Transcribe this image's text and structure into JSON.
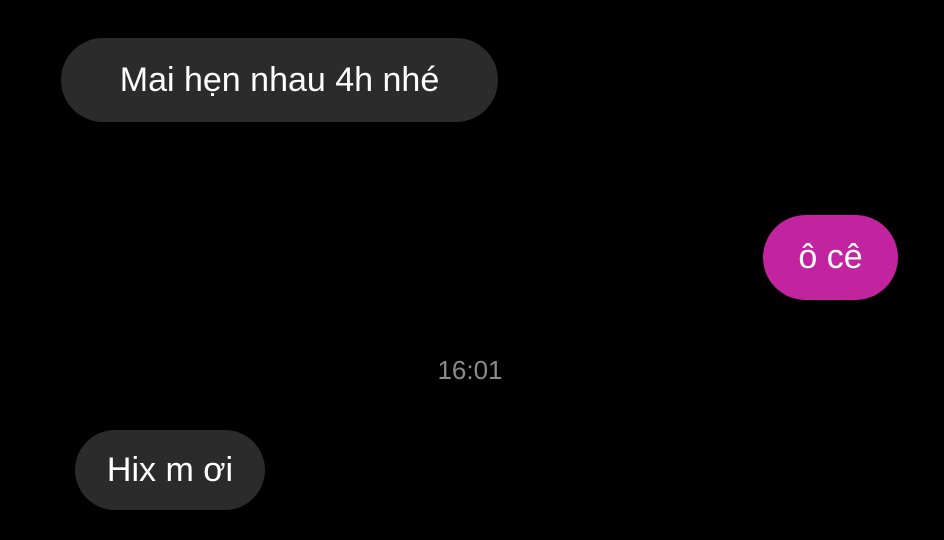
{
  "conversation": {
    "messages": [
      {
        "direction": "incoming",
        "text": "Mai hẹn nhau 4h nhé"
      },
      {
        "direction": "outgoing",
        "text": "ô cê"
      },
      {
        "direction": "incoming",
        "text": "Hix m ơi"
      }
    ],
    "timestamp": "16:01"
  },
  "colors": {
    "background": "#000000",
    "incoming_bubble": "#2b2b2b",
    "outgoing_bubble": "#c2249f",
    "timestamp_text": "#8a8a8a"
  }
}
